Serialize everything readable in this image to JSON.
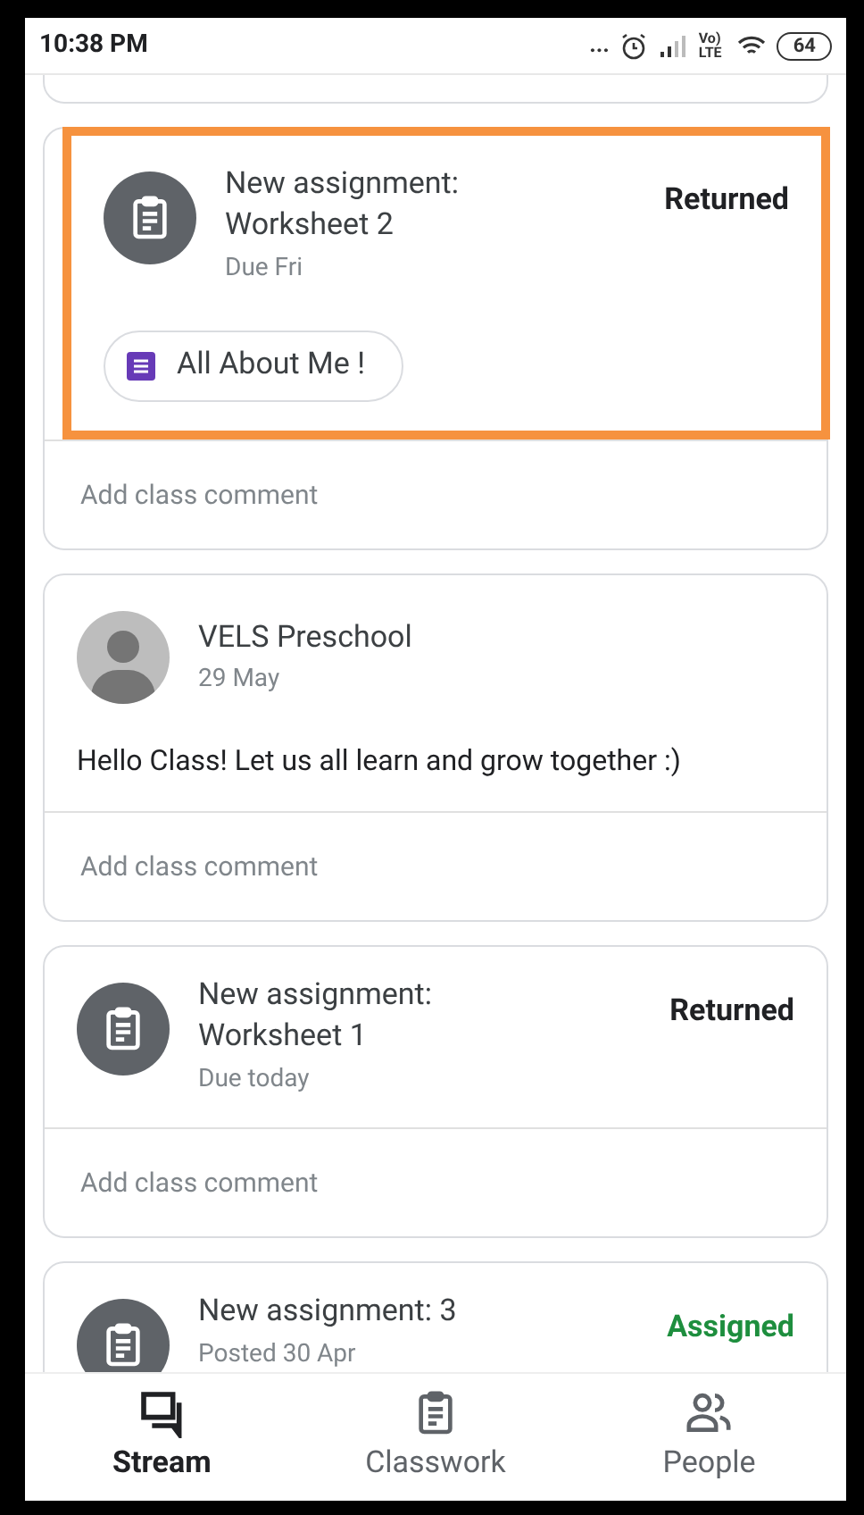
{
  "status_bar": {
    "time": "10:38 PM",
    "dots": "...",
    "network": "Vo) LTE",
    "battery": "64"
  },
  "posts": [
    {
      "kind": "assignment",
      "highlighted": true,
      "title": "New assignment: Worksheet 2",
      "subtitle": "Due Fri",
      "status": {
        "label": "Returned",
        "kind": "returned"
      },
      "attachment": "All About Me !",
      "comment_placeholder": "Add class comment"
    },
    {
      "kind": "announcement",
      "highlighted": false,
      "author": "VELS Preschool",
      "date": "29 May",
      "message": "Hello Class! Let us all learn and grow together :)",
      "comment_placeholder": "Add class comment"
    },
    {
      "kind": "assignment",
      "highlighted": false,
      "title": "New assignment: Worksheet 1",
      "subtitle": "Due today",
      "status": {
        "label": "Returned",
        "kind": "returned"
      },
      "comment_placeholder": "Add class comment"
    },
    {
      "kind": "assignment",
      "highlighted": false,
      "title": "New assignment: 3",
      "subtitle": "Posted 30 Apr",
      "status": {
        "label": "Assigned",
        "kind": "assigned"
      }
    }
  ],
  "nav": [
    {
      "label": "Stream",
      "kind": "stream",
      "selected": true
    },
    {
      "label": "Classwork",
      "kind": "classwork",
      "selected": false
    },
    {
      "label": "People",
      "kind": "people",
      "selected": false
    }
  ]
}
